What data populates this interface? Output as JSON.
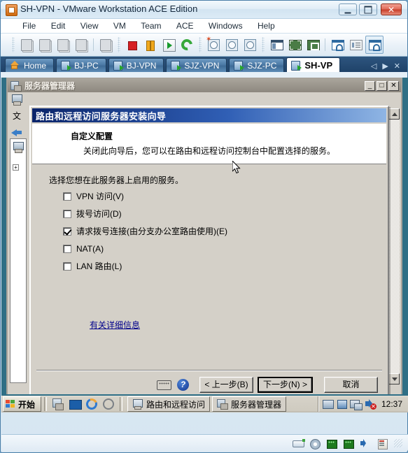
{
  "window": {
    "title": "SH-VPN - VMware Workstation ACE Edition",
    "minimize_label": "",
    "maximize_label": "",
    "close_label": "✕"
  },
  "menubar": {
    "items": [
      "File",
      "Edit",
      "View",
      "VM",
      "Team",
      "ACE",
      "Windows",
      "Help"
    ]
  },
  "toolbar": {
    "icons": [
      "power-on-team-icon",
      "power-off-team-icon",
      "suspend-vm-icon",
      "reset-vm-icon",
      "snapshot-manager-icon",
      "stop-icon",
      "pause-icon",
      "play-icon",
      "reset-icon",
      "take-snapshot-icon",
      "revert-snapshot-icon",
      "manage-snapshots-icon",
      "show-sidebar-icon",
      "quick-switch-icon",
      "full-screen-icon",
      "preferences-icon",
      "summary-view-icon",
      "console-view-icon"
    ]
  },
  "tabs": {
    "items": [
      {
        "label": "Home",
        "icon": "home-icon",
        "active": false
      },
      {
        "label": "BJ-PC",
        "icon": "vm-icon",
        "active": false
      },
      {
        "label": "BJ-VPN",
        "icon": "vm-icon",
        "active": false
      },
      {
        "label": "SJZ-VPN",
        "icon": "vm-icon",
        "active": false
      },
      {
        "label": "SJZ-PC",
        "icon": "vm-icon",
        "active": false
      },
      {
        "label": "SH-VP",
        "icon": "vm-icon",
        "active": true
      }
    ],
    "nav": {
      "prev": "◁",
      "next": "▶",
      "close": "✕"
    }
  },
  "server_manager": {
    "title": "服务器管理器",
    "buttons": {
      "minimize": "_",
      "maximize": "□",
      "close": "✕"
    },
    "sidebar": {
      "label": "文",
      "back_icon": "back-arrow-icon",
      "tree_expander": "+"
    }
  },
  "wizard": {
    "title": "路由和远程访问服务器安装向导",
    "close_label": "✕",
    "header": {
      "title": "自定义配置",
      "subtitle": "关闭此向导后，您可以在路由和远程访问控制台中配置选择的服务。"
    },
    "prompt": "选择您想在此服务器上启用的服务。",
    "options": [
      {
        "label": "VPN 访问(V)",
        "checked": false
      },
      {
        "label": "拨号访问(D)",
        "checked": false
      },
      {
        "label": "请求拨号连接(由分支办公室路由使用)(E)",
        "checked": true
      },
      {
        "label": "NAT(A)",
        "checked": false
      },
      {
        "label": "LAN 路由(L)",
        "checked": false
      }
    ],
    "link": "有关详细信息",
    "footer": {
      "keyboard_icon": "keyboard-icon",
      "help_icon": "help-icon",
      "back": "< 上一步(B)",
      "next": "下一步(N) >",
      "cancel": "取消"
    }
  },
  "taskbar": {
    "start_label": "开始",
    "quick_launch": [
      "show-desktop-icon",
      "desktop-icon",
      "internet-explorer-icon",
      "browser-icon"
    ],
    "tasks": [
      {
        "label": "路由和远程访问",
        "icon": "rras-icon"
      },
      {
        "label": "服务器管理器",
        "icon": "server-manager-icon"
      }
    ],
    "tray_icons": [
      "network-icon",
      "network-connection-icon",
      "monitor-icon",
      "volume-icon"
    ],
    "clock": "12:37"
  },
  "statusbar": {
    "icons": [
      "hard-disk-icon",
      "cd-drive-icon",
      "network-adapter-icon",
      "network-adapter-2-icon",
      "sound-icon",
      "printer-icon"
    ]
  },
  "colors": {
    "accent": "#2d557f",
    "wizard_title_start": "#0a246a",
    "wizard_title_end": "#8fb5e4",
    "dialog_face": "#d4d0c8",
    "link": "#00008b",
    "close_button": "#c63d28"
  }
}
